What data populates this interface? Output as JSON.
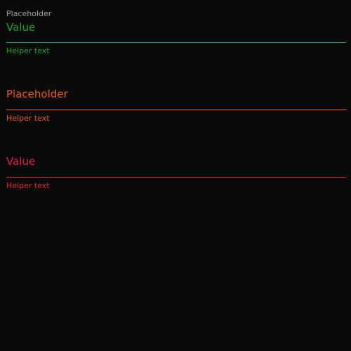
{
  "colors": {
    "background": "#0b0a0a",
    "label_gray": "#a4a4a4",
    "success": "#22a52c",
    "warning": "#e85b22",
    "error": "#e0283a"
  },
  "fields": [
    {
      "state": "success",
      "label": "Placeholder",
      "value": "Value",
      "helper": "Helper text"
    },
    {
      "state": "warning",
      "placeholder": "Placeholder",
      "value": "",
      "helper": "Helper text"
    },
    {
      "state": "error",
      "value": "Value",
      "helper": "Helper text"
    }
  ]
}
